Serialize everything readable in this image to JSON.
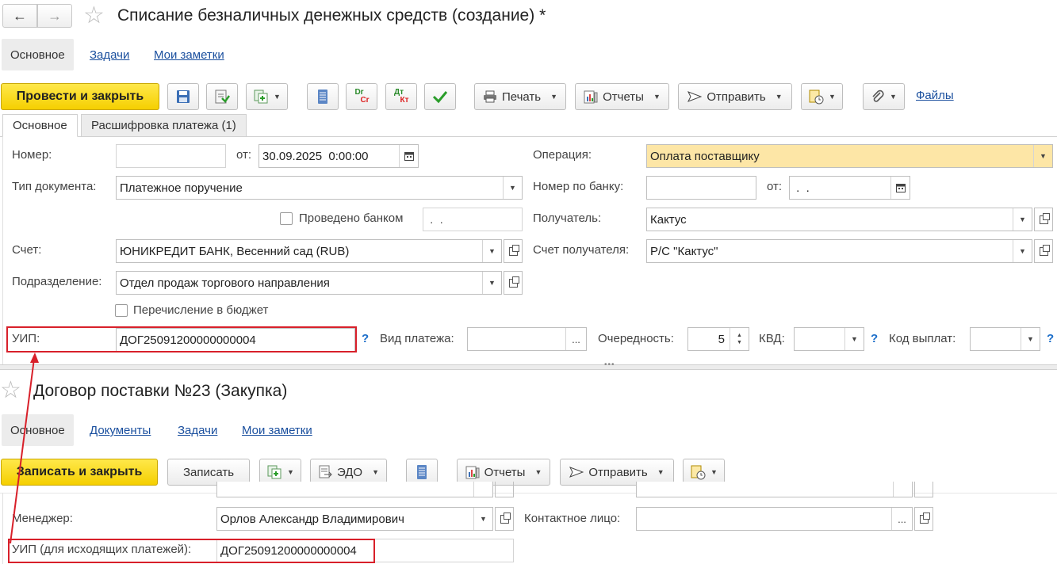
{
  "doc1": {
    "title": "Списание безналичных денежных средств (создание) *",
    "nav_tabs": [
      "Основное",
      "Задачи",
      "Мои заметки"
    ],
    "toolbar": {
      "post_close": "Провести и закрыть",
      "print": "Печать",
      "reports": "Отчеты",
      "send": "Отправить",
      "files": "Файлы",
      "dr_icon_top": "Dr",
      "dr_icon_bottom": "Cr",
      "dt_icon_top": "Дт",
      "dt_icon_bottom": "Кт"
    },
    "form_tabs": [
      "Основное",
      "Расшифровка платежа (1)"
    ],
    "fields": {
      "number_label": "Номер:",
      "number_value": "",
      "from_label": "от:",
      "date_value": "30.09.2025  0:00:00",
      "operation_label": "Операция:",
      "operation_value": "Оплата поставщику",
      "doc_type_label": "Тип документа:",
      "doc_type_value": "Платежное поручение",
      "bank_number_label": "Номер по банку:",
      "bank_number_value": "",
      "bank_from_label": "от:",
      "bank_date_value": " .  .",
      "posted_by_bank_label": "Проведено банком",
      "posted_date_value": " .  .",
      "recipient_label": "Получатель:",
      "recipient_value": "Кактус",
      "account_label": "Счет:",
      "account_value": "ЮНИКРЕДИТ БАНК, Весенний сад (RUB)",
      "recipient_account_label": "Счет получателя:",
      "recipient_account_value": "Р/С \"Кактус\"",
      "division_label": "Подразделение:",
      "division_value": "Отдел продаж торгового направления",
      "budget_label": "Перечисление в бюджет",
      "uip_label": "УИП:",
      "uip_value": "ДОГ25091200000000004",
      "help_mark": "?",
      "payment_type_label": "Вид платежа:",
      "payment_type_value": "",
      "ellipsis": "...",
      "priority_label": "Очередность:",
      "priority_value": "5",
      "kvd_label": "КВД:",
      "kvd_value": "",
      "payout_code_label": "Код выплат:",
      "payout_code_value": ""
    }
  },
  "doc2": {
    "title": "Договор поставки №23 (Закупка)",
    "nav_tabs": [
      "Основное",
      "Документы",
      "Задачи",
      "Мои заметки"
    ],
    "toolbar": {
      "save_close": "Записать и закрыть",
      "save": "Записать",
      "edo": "ЭДО",
      "reports": "Отчеты",
      "send": "Отправить"
    },
    "fields": {
      "manager_label": "Менеджер:",
      "manager_value": "Орлов Александр Владимирович",
      "contact_label": "Контактное лицо:",
      "contact_value": "",
      "ellipsis": "...",
      "uip_label": "УИП (для исходящих платежей):",
      "uip_value": "ДОГ25091200000000004"
    }
  },
  "colors": {
    "accent_yellow": "#f5cf00",
    "highlight_red": "#d8202a",
    "link_blue": "#1a4f9e",
    "warn_field": "#fde6a6"
  }
}
